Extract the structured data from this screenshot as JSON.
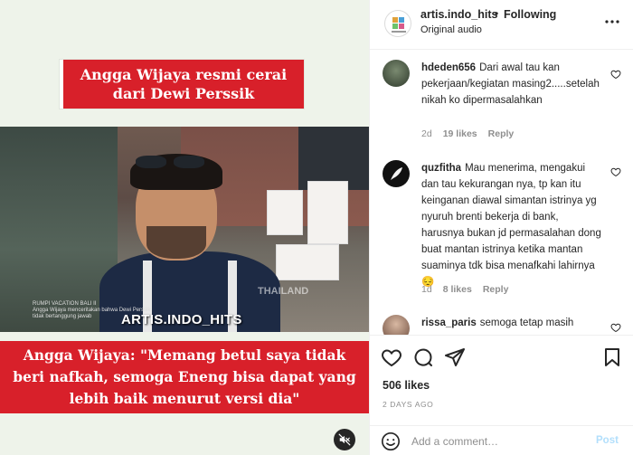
{
  "media": {
    "title_banner": "Angga Wijaya resmi cerai dari Dewi Perssik",
    "quote_banner": "Angga Wijaya: \"Memang betul saya tidak beri nafkah, semoga Eneng bisa dapat yang lebih baik menurut versi dia\"",
    "watermark": "ARTIS.INDO_HITS",
    "faint_watermark": "THAILAND",
    "lower_caption_line1": "RUMPI VACATION BALI II",
    "lower_caption_line2": "Angga Wijaya menceritakan bahwa Dewi Perssik",
    "lower_caption_line3": "tidak bertanggung jawab",
    "mute_icon": "muted-speaker-icon"
  },
  "header": {
    "username": "artis.indo_hits",
    "dot": "•",
    "follow_status": "Following",
    "audio": "Original audio",
    "more_icon": "more-options-icon"
  },
  "comments": [
    {
      "user": "hdeden656",
      "text": "Dari awal tau kan pekerjaan/kegiatan masing2.....setelah nikah ko dipermasalahkan",
      "age": "2d",
      "likes": "19 likes",
      "reply": "Reply"
    },
    {
      "user": "quzfitha",
      "text": "Mau menerima, mengakui dan tau kekurangan nya, tp kan itu keinganan diawal simantan istrinya yg nyuruh brenti bekerja di bank, harusnya bukan jd permasalahan dong buat mantan istrinya ketika mantan suaminya tdk bisa menafkahi lahirnya😔",
      "age": "1d",
      "likes": "8 likes",
      "reply": "Reply"
    },
    {
      "user": "rissa_paris",
      "text": "semoga tetap masih",
      "age": "",
      "likes": "",
      "reply": ""
    }
  ],
  "actions": {
    "likes": "506 likes",
    "posted_ago": "2 DAYS AGO",
    "icons": [
      "heart-icon",
      "comment-icon",
      "share-icon",
      "bookmark-icon"
    ]
  },
  "add_comment": {
    "placeholder": "Add a comment…",
    "post_label": "Post",
    "emoji_icon": "emoji-icon"
  },
  "colors": {
    "banner_red": "#d8202a",
    "text": "#262626",
    "secondary": "#8e8e8e",
    "post_disabled": "#b2dffc"
  }
}
